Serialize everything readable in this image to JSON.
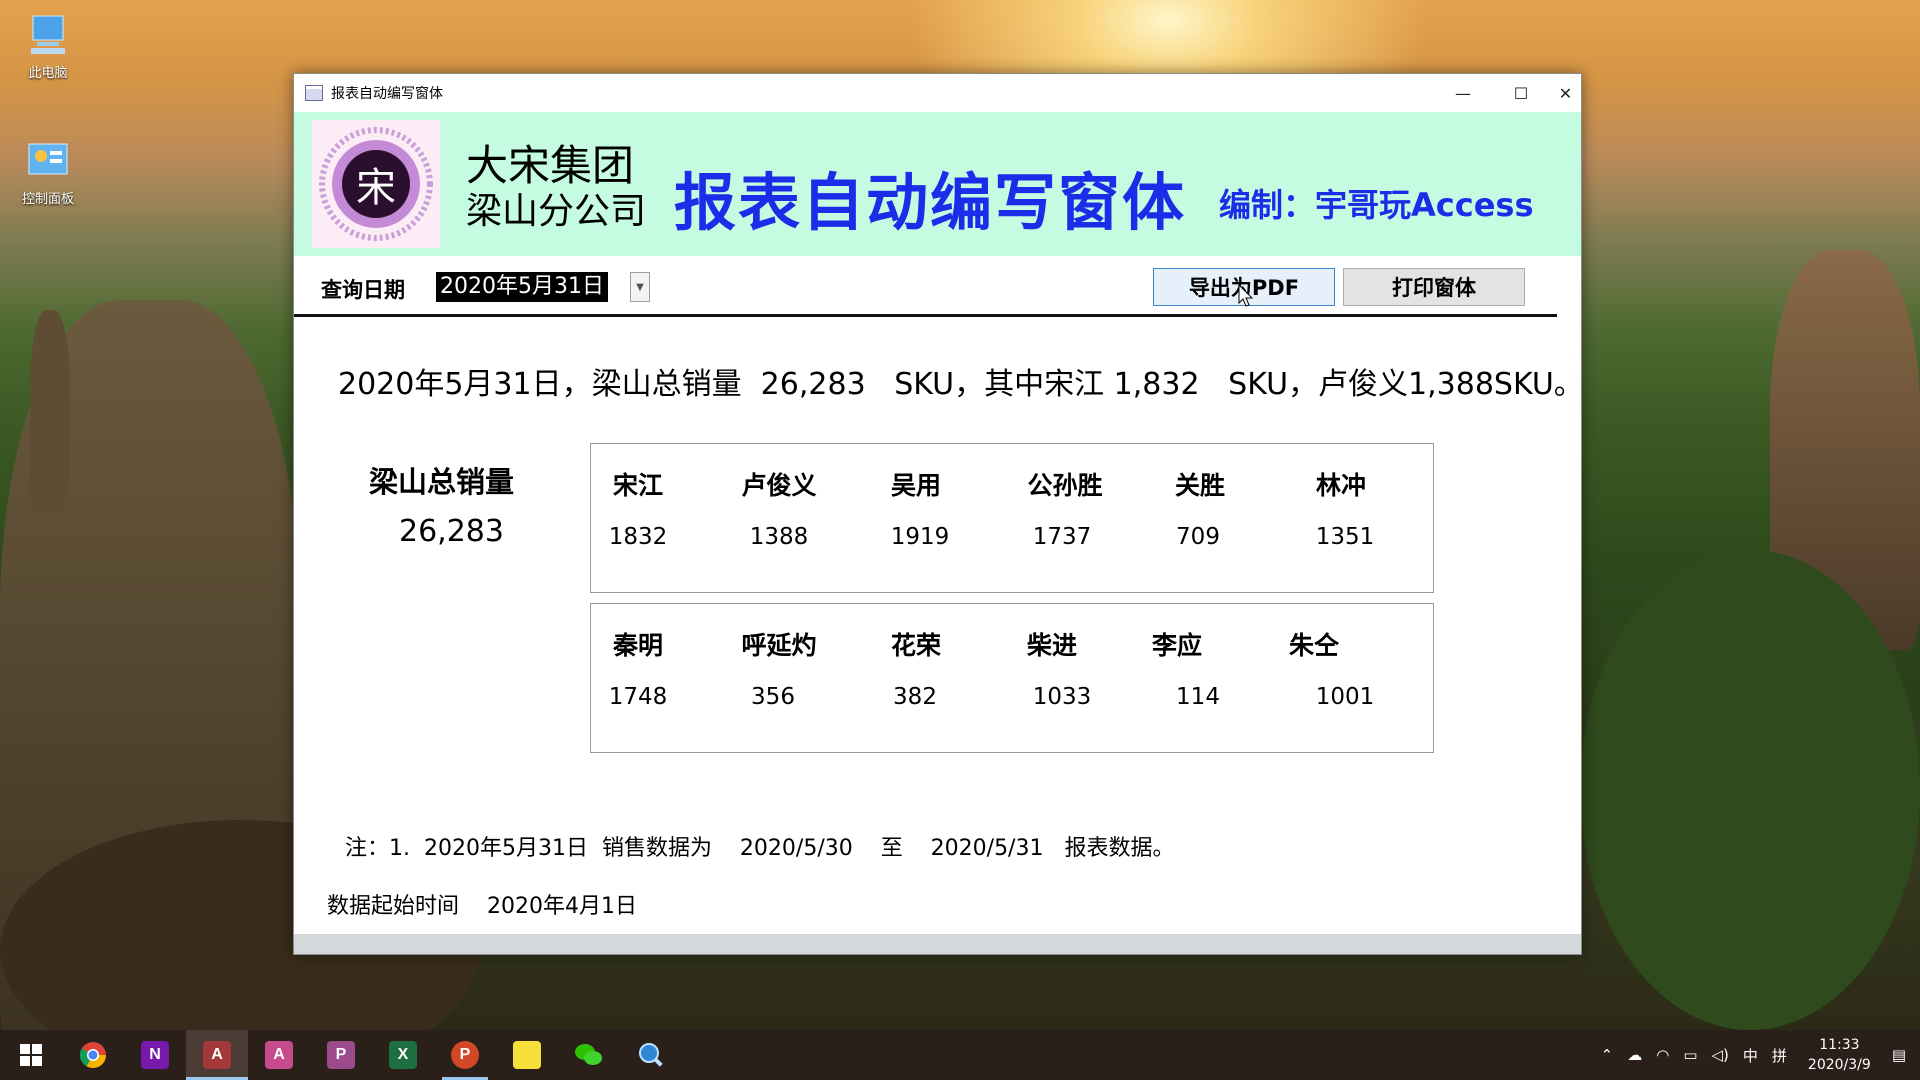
{
  "desktop": {
    "icons": [
      {
        "label": "此电脑",
        "icon": "computer-icon"
      },
      {
        "label": "控制面板",
        "icon": "control-panel-icon"
      }
    ]
  },
  "window": {
    "title": "报表自动编写窗体",
    "controls": {
      "minimize": "—",
      "maximize": "☐",
      "close": "✕"
    },
    "header": {
      "logo_char": "宋",
      "company_line1": "大宋集团",
      "company_line2": "梁山分公司",
      "main_title": "报表自动编写窗体",
      "author": "编制：宇哥玩Access",
      "bg_color": "#c5fbe1",
      "title_color": "#1c2ce8"
    },
    "toolbar": {
      "query_label": "查询日期",
      "query_date": "2020年5月31日",
      "export_pdf_label": "导出为PDF",
      "print_label": "打印窗体"
    },
    "summary": "2020年5月31日，梁山总销量  26,283   SKU，其中宋江 1,832   SKU，卢俊义1,388SKU。",
    "total": {
      "label": "梁山总销量",
      "value": "26,283"
    },
    "grid1": [
      {
        "name": "宋江",
        "value": "1832"
      },
      {
        "name": "卢俊义",
        "value": "1388"
      },
      {
        "name": "吴用",
        "value": "1919"
      },
      {
        "name": "公孙胜",
        "value": "1737"
      },
      {
        "name": "关胜",
        "value": "709"
      },
      {
        "name": "林冲",
        "value": "1351"
      }
    ],
    "grid2": [
      {
        "name": "秦明",
        "value": "1748"
      },
      {
        "name": "呼延灼",
        "value": "356"
      },
      {
        "name": "花荣",
        "value": "382"
      },
      {
        "name": "柴进",
        "value": "1033"
      },
      {
        "name": "李应",
        "value": "114"
      },
      {
        "name": "朱仝",
        "value": "1001"
      }
    ],
    "note": "注：1.  2020年5月31日  销售数据为    2020/5/30    至    2020/5/31   报表数据。",
    "start_label": "数据起始时间",
    "start_value": "2020年4月1日"
  },
  "taskbar": {
    "apps": [
      {
        "name": "start-icon"
      },
      {
        "name": "chrome-icon"
      },
      {
        "name": "onenote-icon",
        "letter": "N"
      },
      {
        "name": "access-icon",
        "letter": "A"
      },
      {
        "name": "access-alt-icon",
        "letter": "A"
      },
      {
        "name": "publisher-icon",
        "letter": "P"
      },
      {
        "name": "excel-icon",
        "letter": "X"
      },
      {
        "name": "powerpoint-icon",
        "letter": "P"
      },
      {
        "name": "sticky-notes-icon"
      },
      {
        "name": "wechat-icon"
      },
      {
        "name": "search-app-icon"
      }
    ],
    "tray": {
      "ime": "中",
      "ime_mode": "拼"
    },
    "clock_time": "11:33",
    "clock_date": "2020/3/9"
  }
}
